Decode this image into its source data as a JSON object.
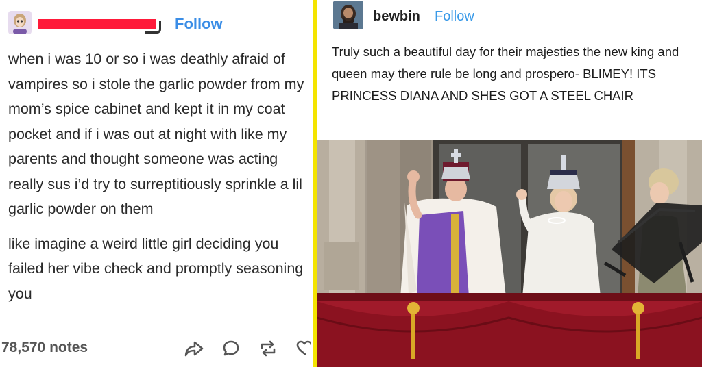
{
  "left_post": {
    "follow_label": "Follow",
    "paragraphs": [
      "when i was 10 or so i was deathly afraid of vampires so i stole the garlic powder from my mom’s spice cabinet and kept it in my coat pocket and if i was out at night with like my parents and thought someone was acting really sus i’d try to surreptitiously sprinkle a lil garlic powder on them",
      "like imagine a weird little girl deciding you failed her vibe check and promptly seasoning you"
    ],
    "notes": "78,570 notes",
    "icons": [
      "share-icon",
      "comment-icon",
      "reblog-icon",
      "heart-icon"
    ]
  },
  "right_post": {
    "username": "bewbin",
    "follow_label": "Follow",
    "text": "Truly such a beautiful day for their majesties the new king and queen may there rule be long and prospero- BLIMEY! ITS PRINCESS DIANA AND SHES GOT A STEEL CHAIR"
  },
  "colors": {
    "divider": "#f4e400",
    "follow_blue": "#3a8de6",
    "redaction": "#ff1a3a",
    "drape": "#8b1220"
  }
}
